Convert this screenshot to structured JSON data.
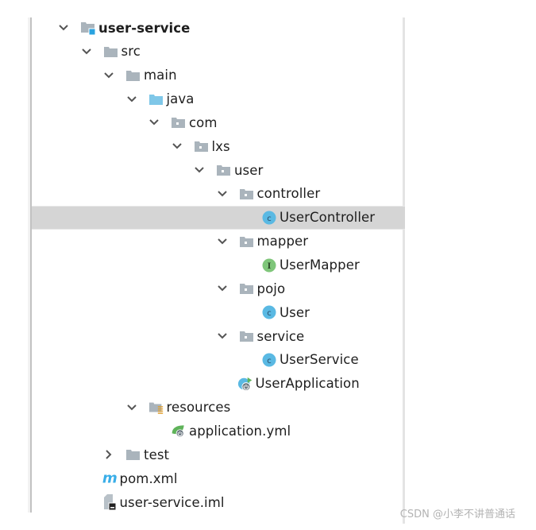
{
  "project_tree": {
    "selected_index": 8,
    "nodes": [
      {
        "label": "user-service",
        "depth": 0,
        "expander": "expanded",
        "icon": "module-folder-icon",
        "bold": true
      },
      {
        "label": "src",
        "depth": 1,
        "expander": "expanded",
        "icon": "folder-icon"
      },
      {
        "label": "main",
        "depth": 2,
        "expander": "expanded",
        "icon": "folder-icon"
      },
      {
        "label": "java",
        "depth": 3,
        "expander": "expanded",
        "icon": "source-root-folder-icon"
      },
      {
        "label": "com",
        "depth": 4,
        "expander": "expanded",
        "icon": "package-icon"
      },
      {
        "label": "lxs",
        "depth": 5,
        "expander": "expanded",
        "icon": "package-icon"
      },
      {
        "label": "user",
        "depth": 6,
        "expander": "expanded",
        "icon": "package-icon"
      },
      {
        "label": "controller",
        "depth": 7,
        "expander": "expanded",
        "icon": "package-icon"
      },
      {
        "label": "UserController",
        "depth": 8,
        "expander": "none",
        "icon": "class-icon"
      },
      {
        "label": "mapper",
        "depth": 7,
        "expander": "expanded",
        "icon": "package-icon"
      },
      {
        "label": "UserMapper",
        "depth": 8,
        "expander": "none",
        "icon": "interface-icon"
      },
      {
        "label": "pojo",
        "depth": 7,
        "expander": "expanded",
        "icon": "package-icon"
      },
      {
        "label": "User",
        "depth": 8,
        "expander": "none",
        "icon": "class-icon"
      },
      {
        "label": "service",
        "depth": 7,
        "expander": "expanded",
        "icon": "package-icon"
      },
      {
        "label": "UserService",
        "depth": 8,
        "expander": "none",
        "icon": "class-icon"
      },
      {
        "label": "UserApplication",
        "depth": 7,
        "expander": "none",
        "icon": "spring-boot-application-icon",
        "noChevSlot": true
      },
      {
        "label": "resources",
        "depth": 3,
        "expander": "expanded",
        "icon": "resources-folder-icon"
      },
      {
        "label": "application.yml",
        "depth": 4,
        "expander": "none",
        "icon": "spring-config-icon"
      },
      {
        "label": "test",
        "depth": 2,
        "expander": "collapsed",
        "icon": "folder-icon"
      },
      {
        "label": "pom.xml",
        "depth": 1,
        "expander": "none",
        "icon": "maven-icon",
        "noChevSlot": true
      },
      {
        "label": "user-service.iml",
        "depth": 1,
        "expander": "none",
        "icon": "iml-file-icon",
        "noChevSlot": true
      }
    ]
  },
  "colors": {
    "folder": "#aab4bc",
    "source_root": "#7fc7e8",
    "class_icon": "#5ab9e3",
    "interface_icon": "#7fc67a",
    "module_badge": "#2aa3e0",
    "spring_green": "#5fb35a",
    "maven_blue": "#3aaee8",
    "selected_row": "#d5d5d5"
  },
  "watermark": {
    "text": "CSDN @小李不讲普通话"
  }
}
